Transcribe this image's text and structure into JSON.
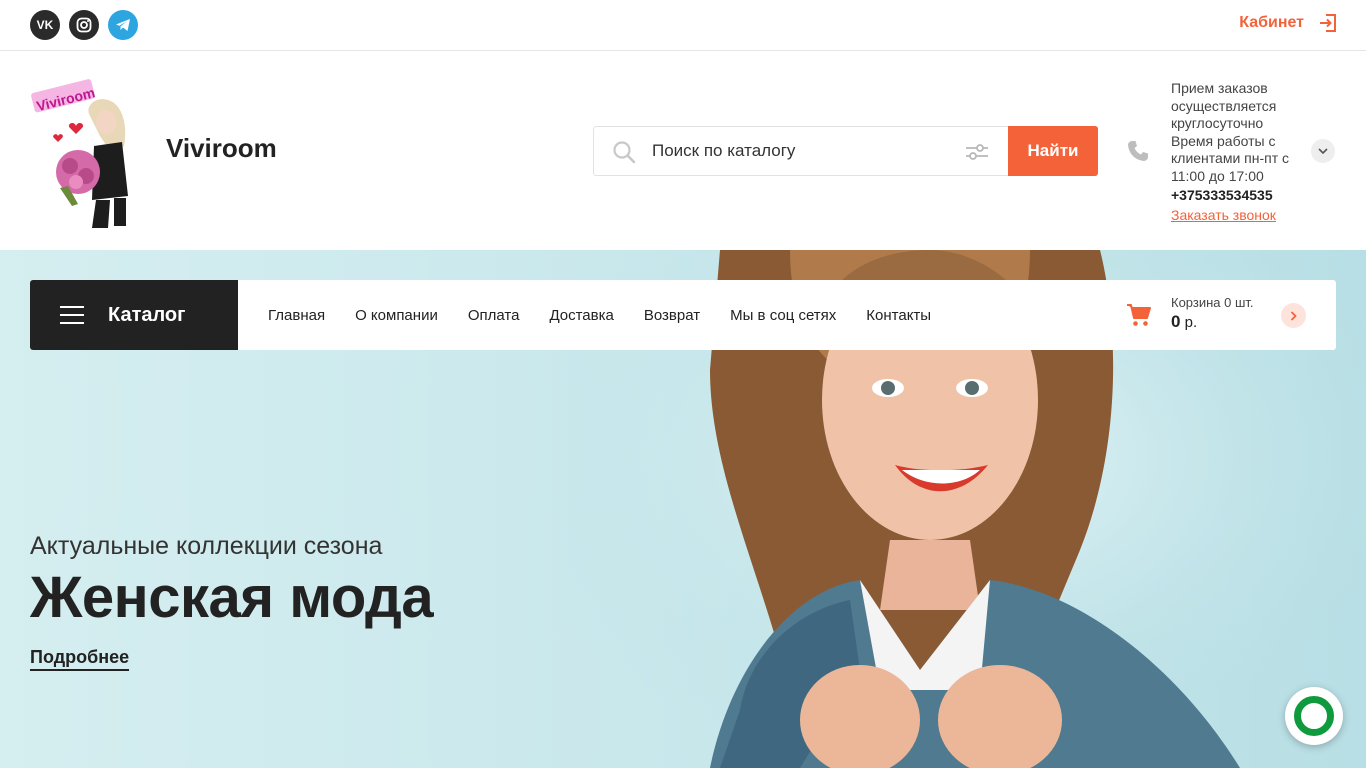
{
  "topbar": {
    "social": [
      {
        "name": "vk-icon",
        "label": "VK"
      },
      {
        "name": "instagram-icon",
        "label": ""
      },
      {
        "name": "telegram-icon",
        "label": ""
      }
    ],
    "cabinet_label": "Кабинет"
  },
  "header": {
    "logo_text": "Viviroom",
    "brand": "Viviroom",
    "search": {
      "placeholder": "Поиск по каталогу",
      "button_label": "Найти"
    },
    "contact": {
      "info": "Прием заказов осуществляется круглосуточно Время работы с клиентами пн-пт с 11:00 до 17:00",
      "phone": "+375333534535",
      "callback_label": "Заказать звонок"
    }
  },
  "nav": {
    "catalog_label": "Каталог",
    "items": [
      "Главная",
      "О компании",
      "Оплата",
      "Доставка",
      "Возврат",
      "Мы в соц сетях",
      "Контакты"
    ],
    "cart_label": "Корзина 0 шт.",
    "cart_sum": "0",
    "cart_currency": " р."
  },
  "hero": {
    "subtitle": "Актуальные коллекции сезона",
    "title": "Женская мода",
    "more_label": "Подробнее"
  },
  "colors": {
    "accent": "#f4623a",
    "dark": "#222222",
    "hero_bg": "#c9e8ec",
    "chat": "#0e9a3d"
  }
}
